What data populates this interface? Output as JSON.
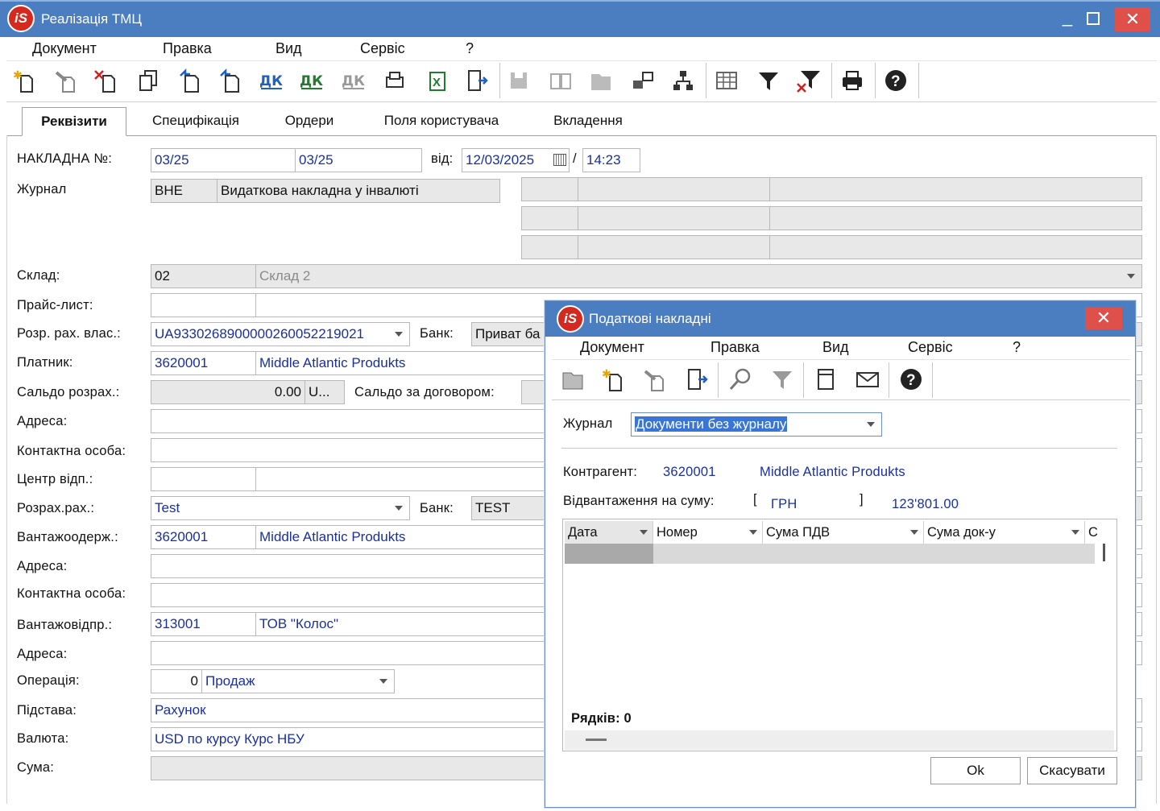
{
  "window": {
    "title": "Реалізація ТМЦ",
    "logo": "iS"
  },
  "menu": [
    "Документ",
    "Правка",
    "Вид",
    "Сервіс",
    "?"
  ],
  "toolbar_icons": [
    "new-doc-icon",
    "edit-doc-icon",
    "delete-doc-icon",
    "copy-doc-icon",
    "undo-doc-icon",
    "redo-doc-icon",
    "dk-icon",
    "dk-green-icon",
    "dk-gray-icon",
    "print-preview-icon",
    "excel-icon",
    "exit-icon",
    "save-icon",
    "book-icon",
    "folder-icon",
    "link-icon",
    "tree-icon",
    "grid-icon",
    "filter-icon",
    "clear-filter-icon",
    "printer-icon",
    "help-icon"
  ],
  "tabs": [
    "Реквізити",
    "Специфікація",
    "Ордери",
    "Поля користувача",
    "Вкладення"
  ],
  "form": {
    "invoice_label": "НАКЛАДНА №:",
    "invoice_no1": "03/25",
    "invoice_no2": "03/25",
    "from_label": "від:",
    "date": "12/03/2025",
    "slash": "/",
    "time": "14:23",
    "journal_label": "Журнал",
    "journal_code": "ВНЕ",
    "journal_name": "Видаткова накладна у інвалюті",
    "warehouse_label": "Склад:",
    "warehouse_code": "02",
    "warehouse_name": "Склад 2",
    "pricelist_label": "Прайс-лист:",
    "own_account_label": "Розр. рах. влас.:",
    "own_account": "UA933026890000026005221902​1",
    "bank_label": "Банк:",
    "own_bank": "Приват ба",
    "payer_label": "Платник:",
    "payer_code": "3620001",
    "payer_name": "Middle Atlantic Produkts",
    "balance_label": "Сальдо розрах.:",
    "balance": "0.00",
    "balance_cur": "U...",
    "contract_balance_label": "Сальдо за договором:",
    "address_label": "Адреса:",
    "contact_label": "Контактна особа:",
    "center_label": "Центр відп.:",
    "account_label": "Розрах.рах.:",
    "account": "Test",
    "bank2_label": "Банк:",
    "bank2": "TEST",
    "consignee_label": "Вантажоодерж.:",
    "consignee_code": "3620001",
    "consignee_name": "Middle Atlantic Produkts",
    "address2_label": "Адреса:",
    "contact2_label": "Контактна особа:",
    "shipper_label": "Вантажовідпр.:",
    "shipper_code": "313001",
    "shipper_name": "ТОВ \"Колос\"",
    "address3_label": "Адреса:",
    "operation_label": "Операція:",
    "operation_code": "0",
    "operation_name": "Продаж",
    "basis_label": "Підстава:",
    "basis": "Рахунок",
    "currency_label": "Валюта:",
    "currency": "USD по курсу Курс НБУ",
    "sum_label": "Сума:"
  },
  "dialog": {
    "title": "Податкові накладні",
    "menu": [
      "Документ",
      "Правка",
      "Вид",
      "Сервіс",
      "?"
    ],
    "toolbar_icons": [
      "open-folder-icon",
      "new-doc-icon",
      "edit-doc-icon",
      "exit-icon",
      "search-icon",
      "filter-icon",
      "document-icon",
      "envelope-icon",
      "help-icon"
    ],
    "journal_label": "Журнал",
    "journal_value": "Документи без журналу",
    "counterparty_label": "Контрагент:",
    "counterparty_code": "3620001",
    "counterparty_name": "Middle Atlantic Produkts",
    "shipment_label": "Відвантаження на суму:",
    "bracket_open": "[",
    "currency": "ГРН",
    "bracket_close": "]",
    "shipment_sum": "123'801.00",
    "columns": [
      "Дата",
      "Номер",
      "Сума ПДВ",
      "Сума  док-у",
      "С"
    ],
    "rows_label": "Рядків: 0",
    "ok": "Ok",
    "cancel": "Скасувати"
  }
}
